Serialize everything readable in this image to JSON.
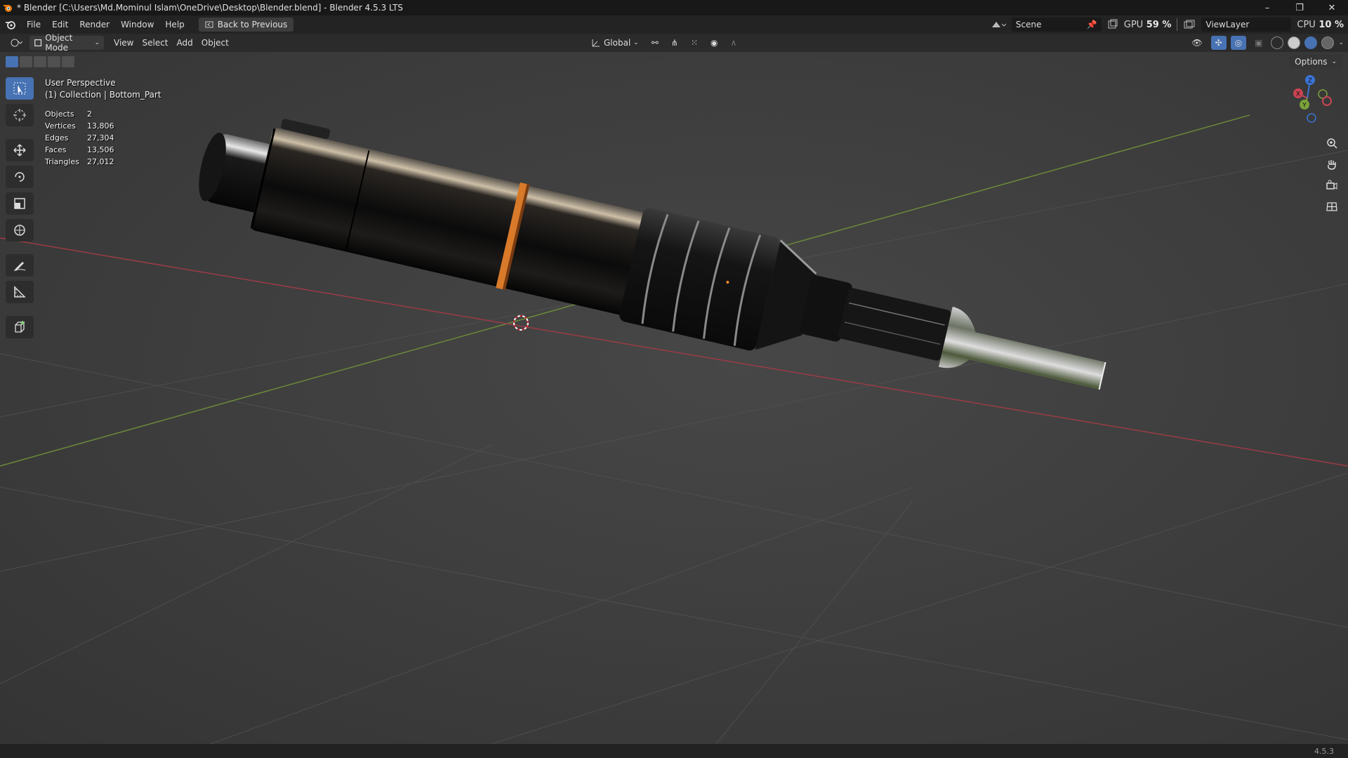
{
  "window": {
    "title": "* Blender [C:\\Users\\Md.Mominul Islam\\OneDrive\\Desktop\\Blender.blend] - Blender 4.5.3 LTS",
    "controls": [
      "–",
      "❐",
      "✕"
    ]
  },
  "menu": {
    "items": [
      "File",
      "Edit",
      "Render",
      "Window",
      "Help"
    ],
    "back_button": "Back to Previous"
  },
  "top_right": {
    "scene": "Scene",
    "view_layer": "ViewLayer",
    "gpu_label": "GPU",
    "gpu_value": "59 %",
    "cpu_label": "CPU",
    "cpu_value": "10 %"
  },
  "viewport_header": {
    "mode": "Object Mode",
    "menus": [
      "View",
      "Select",
      "Add",
      "Object"
    ],
    "transform_orientation": "Global",
    "options": "Options"
  },
  "overlay": {
    "view_name": "User Perspective",
    "collection": "(1) Collection | Bottom_Part"
  },
  "stats": [
    {
      "label": "Objects",
      "value": "2"
    },
    {
      "label": "Vertices",
      "value": "13,806"
    },
    {
      "label": "Edges",
      "value": "27,304"
    },
    {
      "label": "Faces",
      "value": "13,506"
    },
    {
      "label": "Triangles",
      "value": "27,012"
    }
  ],
  "gizmo": {
    "x": "X",
    "y": "Y",
    "z": "Z"
  },
  "status": {
    "version": "4.5.3"
  },
  "colors": {
    "accent": "#4772b3",
    "copper": "#d87a2a",
    "x_axis": "#c94453",
    "y_axis": "#7aa23a",
    "z_axis": "#3b73d6"
  }
}
